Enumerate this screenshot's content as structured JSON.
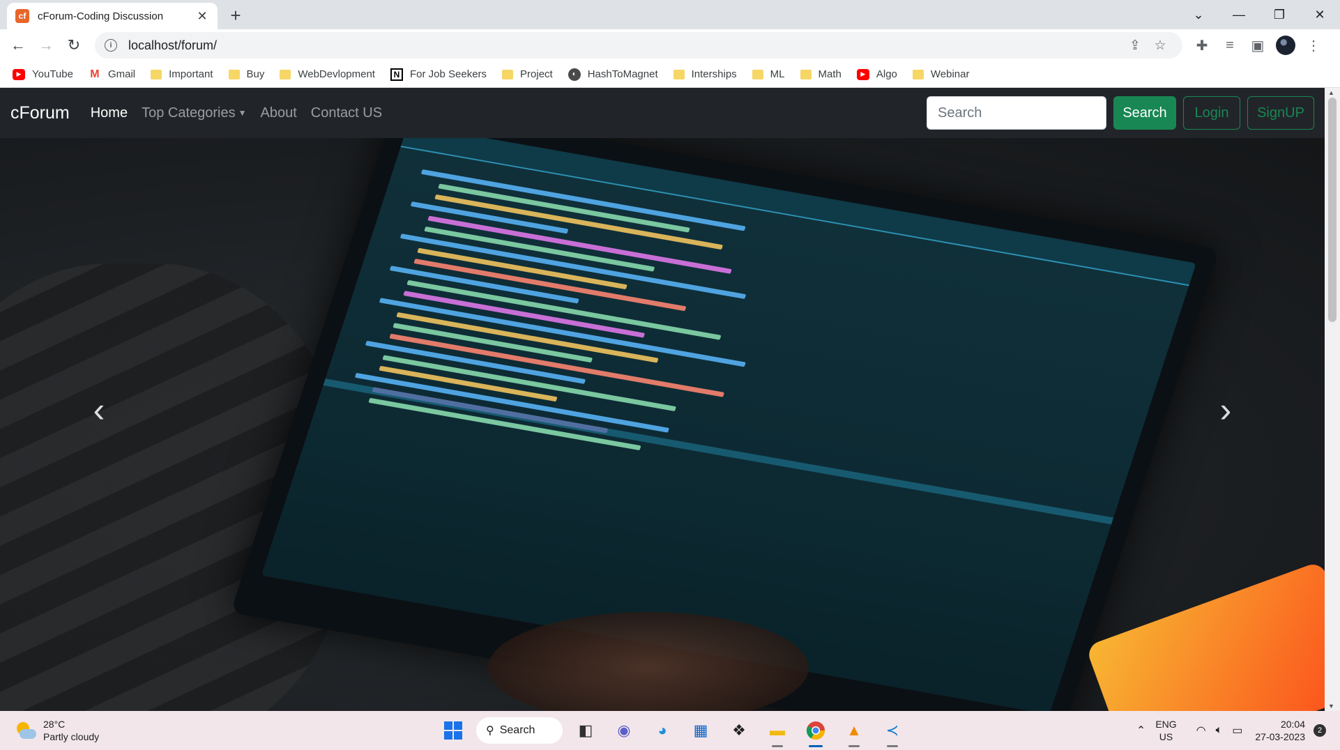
{
  "browser": {
    "tab": {
      "title": "cForum-Coding Discussion",
      "favicon": "cf",
      "close": "✕"
    },
    "new_tab": "+",
    "window_controls": [
      "⌄",
      "—",
      "❐",
      "✕"
    ],
    "url": "localhost/forum/",
    "bookmarks": [
      {
        "label": "YouTube",
        "icon": "youtube-icon"
      },
      {
        "label": "Gmail",
        "icon": "gmail-icon"
      },
      {
        "label": "Important",
        "icon": "folder-icon"
      },
      {
        "label": "Buy",
        "icon": "folder-icon"
      },
      {
        "label": "WebDevlopment",
        "icon": "folder-icon"
      },
      {
        "label": "For Job Seekers",
        "icon": "notion-icon"
      },
      {
        "label": "Project",
        "icon": "folder-icon"
      },
      {
        "label": "HashToMagnet",
        "icon": "globe-icon"
      },
      {
        "label": "Interships",
        "icon": "folder-icon"
      },
      {
        "label": "ML",
        "icon": "folder-icon"
      },
      {
        "label": "Math",
        "icon": "folder-icon"
      },
      {
        "label": "Algo",
        "icon": "youtube-icon"
      },
      {
        "label": "Webinar",
        "icon": "folder-icon"
      }
    ]
  },
  "navbar": {
    "brand": "cForum",
    "links": [
      {
        "label": "Home",
        "active": true
      },
      {
        "label": "Top Categories",
        "dropdown": true
      },
      {
        "label": "About"
      },
      {
        "label": "Contact US"
      }
    ],
    "search_placeholder": "Search",
    "search_button": "Search",
    "login_button": "Login",
    "signup_button": "SignUP"
  },
  "carousel": {
    "prev": "‹",
    "next": "›"
  },
  "taskbar": {
    "weather": {
      "temp": "28°C",
      "condition": "Partly cloudy"
    },
    "search_label": "Search",
    "language": {
      "line1": "ENG",
      "line2": "US"
    },
    "time": "20:04",
    "date": "27-03-2023",
    "notifications": "2"
  },
  "colors": {
    "navbar_bg": "#212529",
    "success": "#198754",
    "taskbar_bg": "#f2e6eb"
  }
}
